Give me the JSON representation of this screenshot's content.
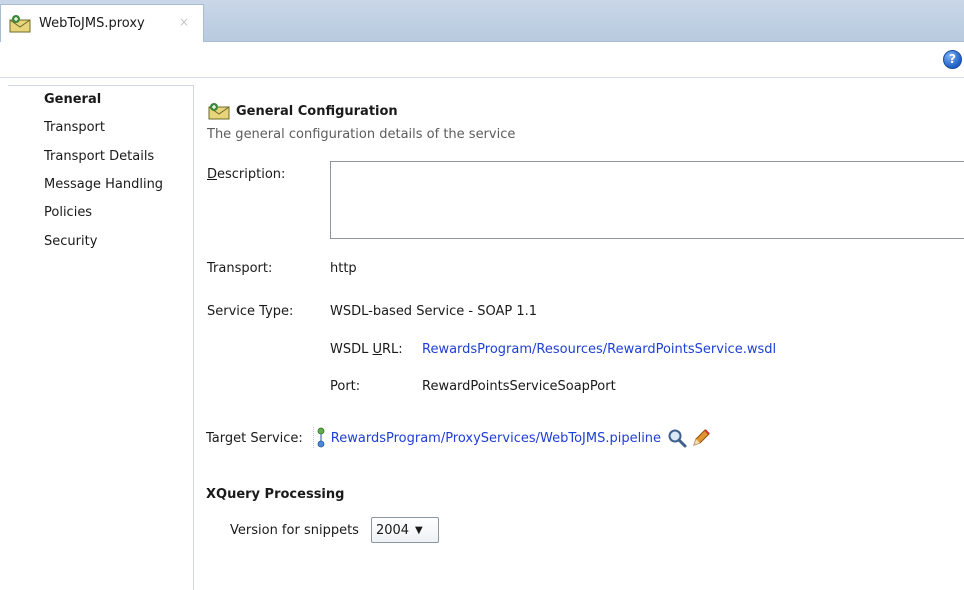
{
  "tab": {
    "label": "WebToJMS.proxy",
    "close": "×"
  },
  "toolbar": {
    "help": "?"
  },
  "sidebar": {
    "items": [
      {
        "label": "General",
        "active": true
      },
      {
        "label": "Transport"
      },
      {
        "label": "Transport Details"
      },
      {
        "label": "Message Handling"
      },
      {
        "label": "Policies"
      },
      {
        "label": "Security"
      }
    ]
  },
  "general": {
    "title": "General Configuration",
    "subtitle": "The general configuration details of the service",
    "description_label_underlined": "D",
    "description_label_rest": "escription:",
    "description_value": "",
    "transport_label": "Transport:",
    "transport_value": "http",
    "service_type_label": "Service Type:",
    "service_type_value": "WSDL-based Service - SOAP 1.1",
    "wsdl_url_label_pre": "WSDL ",
    "wsdl_url_label_underlined": "U",
    "wsdl_url_label_rest": "RL:",
    "wsdl_url_value": "RewardsProgram/Resources/RewardPointsService.wsdl",
    "port_label": "Port:",
    "port_value": "RewardPointsServiceSoapPort",
    "target_service_label": "Target Service:",
    "target_service_value": "RewardsProgram/ProxyServices/WebToJMS.pipeline",
    "target_icons": [
      "node-icon",
      "search-icon",
      "edit-icon"
    ]
  },
  "xquery": {
    "title": "XQuery Processing",
    "version_label": "Version for snippets",
    "version_value": "2004",
    "caret": "▼"
  },
  "colors": {
    "link": "#1f3fd4",
    "tabbar": "#c9d7e8"
  }
}
